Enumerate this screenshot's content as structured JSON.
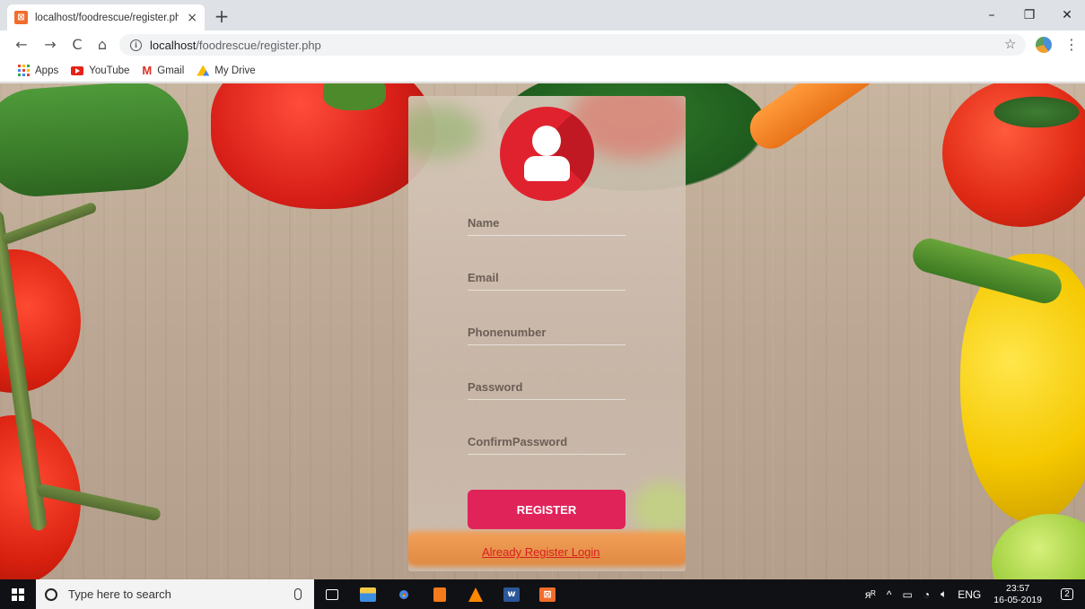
{
  "browser": {
    "tab_title": "localhost/foodrescue/register.ph",
    "tab_close": "×",
    "new_tab": "+",
    "window_controls": {
      "minimize": "–",
      "maximize": "❐",
      "close": "✕"
    },
    "nav": {
      "back": "←",
      "forward": "→",
      "reload": "C",
      "home": "⌂"
    },
    "url_host": "localhost",
    "url_path": "/foodrescue/register.php",
    "star": "☆",
    "menu": "⋮",
    "bookmarks": [
      {
        "label": "Apps",
        "icon": "apps-grid-icon"
      },
      {
        "label": "YouTube",
        "icon": "youtube-icon"
      },
      {
        "label": "Gmail",
        "icon": "gmail-icon"
      },
      {
        "label": "My Drive",
        "icon": "drive-icon"
      }
    ]
  },
  "form": {
    "fields": [
      {
        "name": "name",
        "placeholder": "Name"
      },
      {
        "name": "email",
        "placeholder": "Email"
      },
      {
        "name": "phonenumber",
        "placeholder": "Phonenumber"
      },
      {
        "name": "password",
        "placeholder": "Password"
      },
      {
        "name": "confirm_password",
        "placeholder": "ConfirmPassword"
      }
    ],
    "register_label": "REGISTER",
    "login_link": "Already Register Login",
    "accent_color": "#e0245a",
    "avatar_color": "#e0222f"
  },
  "taskbar": {
    "search_placeholder": "Type here to search",
    "pinned_apps": [
      "task-view",
      "file-explorer",
      "chrome",
      "sublime-text",
      "vlc",
      "word",
      "xampp"
    ],
    "tray": {
      "people": "ᴙᴿ",
      "chevron": "^",
      "language": "ENG",
      "time": "23:57",
      "date": "16-05-2019",
      "notifications": "2"
    }
  }
}
